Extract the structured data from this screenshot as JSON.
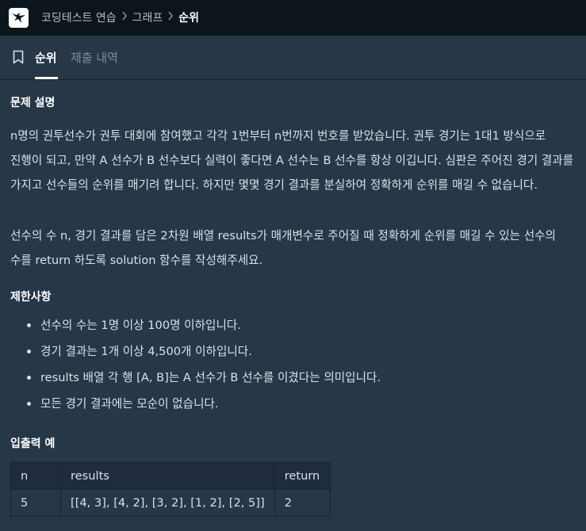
{
  "header": {
    "breadcrumbs": [
      "코딩테스트 연습",
      "그래프"
    ],
    "current": "순위",
    "separator": "〉"
  },
  "tabs": [
    {
      "label": "순위",
      "active": true
    },
    {
      "label": "제출 내역",
      "active": false
    }
  ],
  "problem": {
    "heading": "문제 설명",
    "paragraph1": "n명의 권투선수가 권투 대회에 참여했고 각각 1번부터 n번까지 번호를 받았습니다. 권투 경기는 1대1 방식으로 진행이 되고, 만약 A 선수가 B 선수보다 실력이 좋다면 A 선수는 B 선수를 항상 이깁니다. 심판은 주어진 경기 결과를 가지고 선수들의 순위를 매기려 합니다. 하지만 몇몇 경기 결과를 분실하여 정확하게 순위를 매길 수 없습니다.",
    "paragraph2": "선수의 수 n, 경기 결과를 담은 2차원 배열 results가 매개변수로 주어질 때 정확하게 순위를 매길 수 있는 선수의 수를 return 하도록 solution 함수를 작성해주세요."
  },
  "limits": {
    "heading": "제한사항",
    "items": [
      "선수의 수는 1명 이상 100명 이하입니다.",
      "경기 결과는 1개 이상 4,500개 이하입니다.",
      "results 배열 각 행 [A, B]는 A 선수가 B 선수를 이겼다는 의미입니다.",
      "모든 경기 결과에는 모순이 없습니다."
    ]
  },
  "io": {
    "heading": "입출력 예",
    "columns": [
      "n",
      "results",
      "return"
    ],
    "rows": [
      [
        "5",
        "[[4, 3], [4, 2], [3, 2], [1, 2], [2, 5]]",
        "2"
      ]
    ]
  },
  "colors": {
    "topbar": "#0c151c",
    "background": "#263747",
    "text": "#d7e2eb",
    "table_header": "#202b3d"
  }
}
